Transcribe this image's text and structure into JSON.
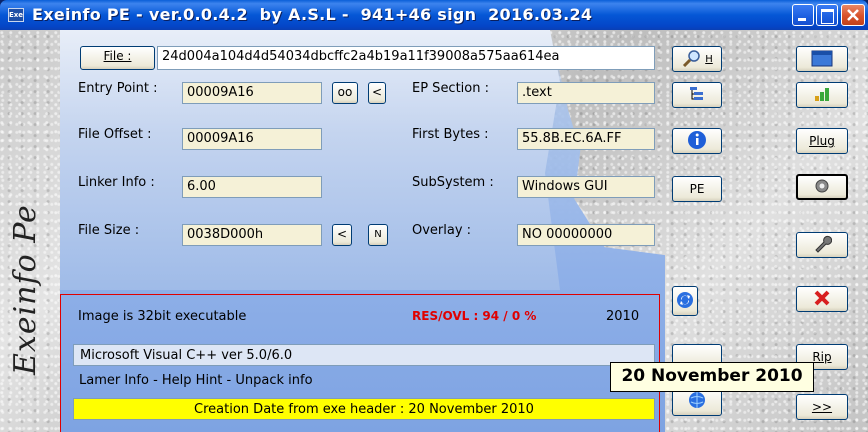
{
  "window": {
    "title": "Exeinfo PE - ver.0.0.4.2  by A.S.L -  941+46 sign  2016.03.24",
    "app_icon": "exe-icon",
    "signature": "Exeinfo Pe"
  },
  "file": {
    "button_label": "File :",
    "value": "24d004a104d4d54034dbcffc2a4b19a11f39008a575aa614ea"
  },
  "fields": {
    "entry_point": {
      "label": "Entry Point :",
      "value": "00009A16",
      "oo_label": "oo",
      "arrow_label": "<"
    },
    "ep_section": {
      "label": "EP Section :",
      "value": ".text"
    },
    "file_offset": {
      "label": "File Offset :",
      "value": "00009A16"
    },
    "first_bytes": {
      "label": "First Bytes :",
      "value": "55.8B.EC.6A.FF"
    },
    "linker_info": {
      "label": "Linker Info :",
      "value": "6.00"
    },
    "subsystem": {
      "label": "SubSystem :",
      "value": "Windows GUI"
    },
    "file_size": {
      "label": "File Size :",
      "value": "0038D000h",
      "arrow_label": "<",
      "n_label": "N"
    },
    "overlay": {
      "label": "Overlay :",
      "value": "NO  00000000"
    }
  },
  "info": {
    "image_type": "Image is 32bit executable",
    "res_ovl": "RES/OVL : 94 / 0 %",
    "year": "2010",
    "compiler": "Microsoft Visual C++ ver 5.0/6.0",
    "lamer_info": "Lamer Info - Help Hint - Unpack info",
    "creation_date": "Creation Date from exe header : 20 November 2010"
  },
  "tooltip": "20 November 2010",
  "center_buttons": {
    "search_label": "H",
    "pe_label": "PE"
  },
  "right_buttons": {
    "plug_label": "Plug",
    "rip_label": "Rip",
    "more_label": ">>"
  },
  "colors": {
    "title_bar": "#0557d6",
    "field_bg": "#f5f1d7",
    "res_ovl": "#e00000",
    "creation_bar": "#ffff00",
    "red_frame": "#e00000"
  }
}
